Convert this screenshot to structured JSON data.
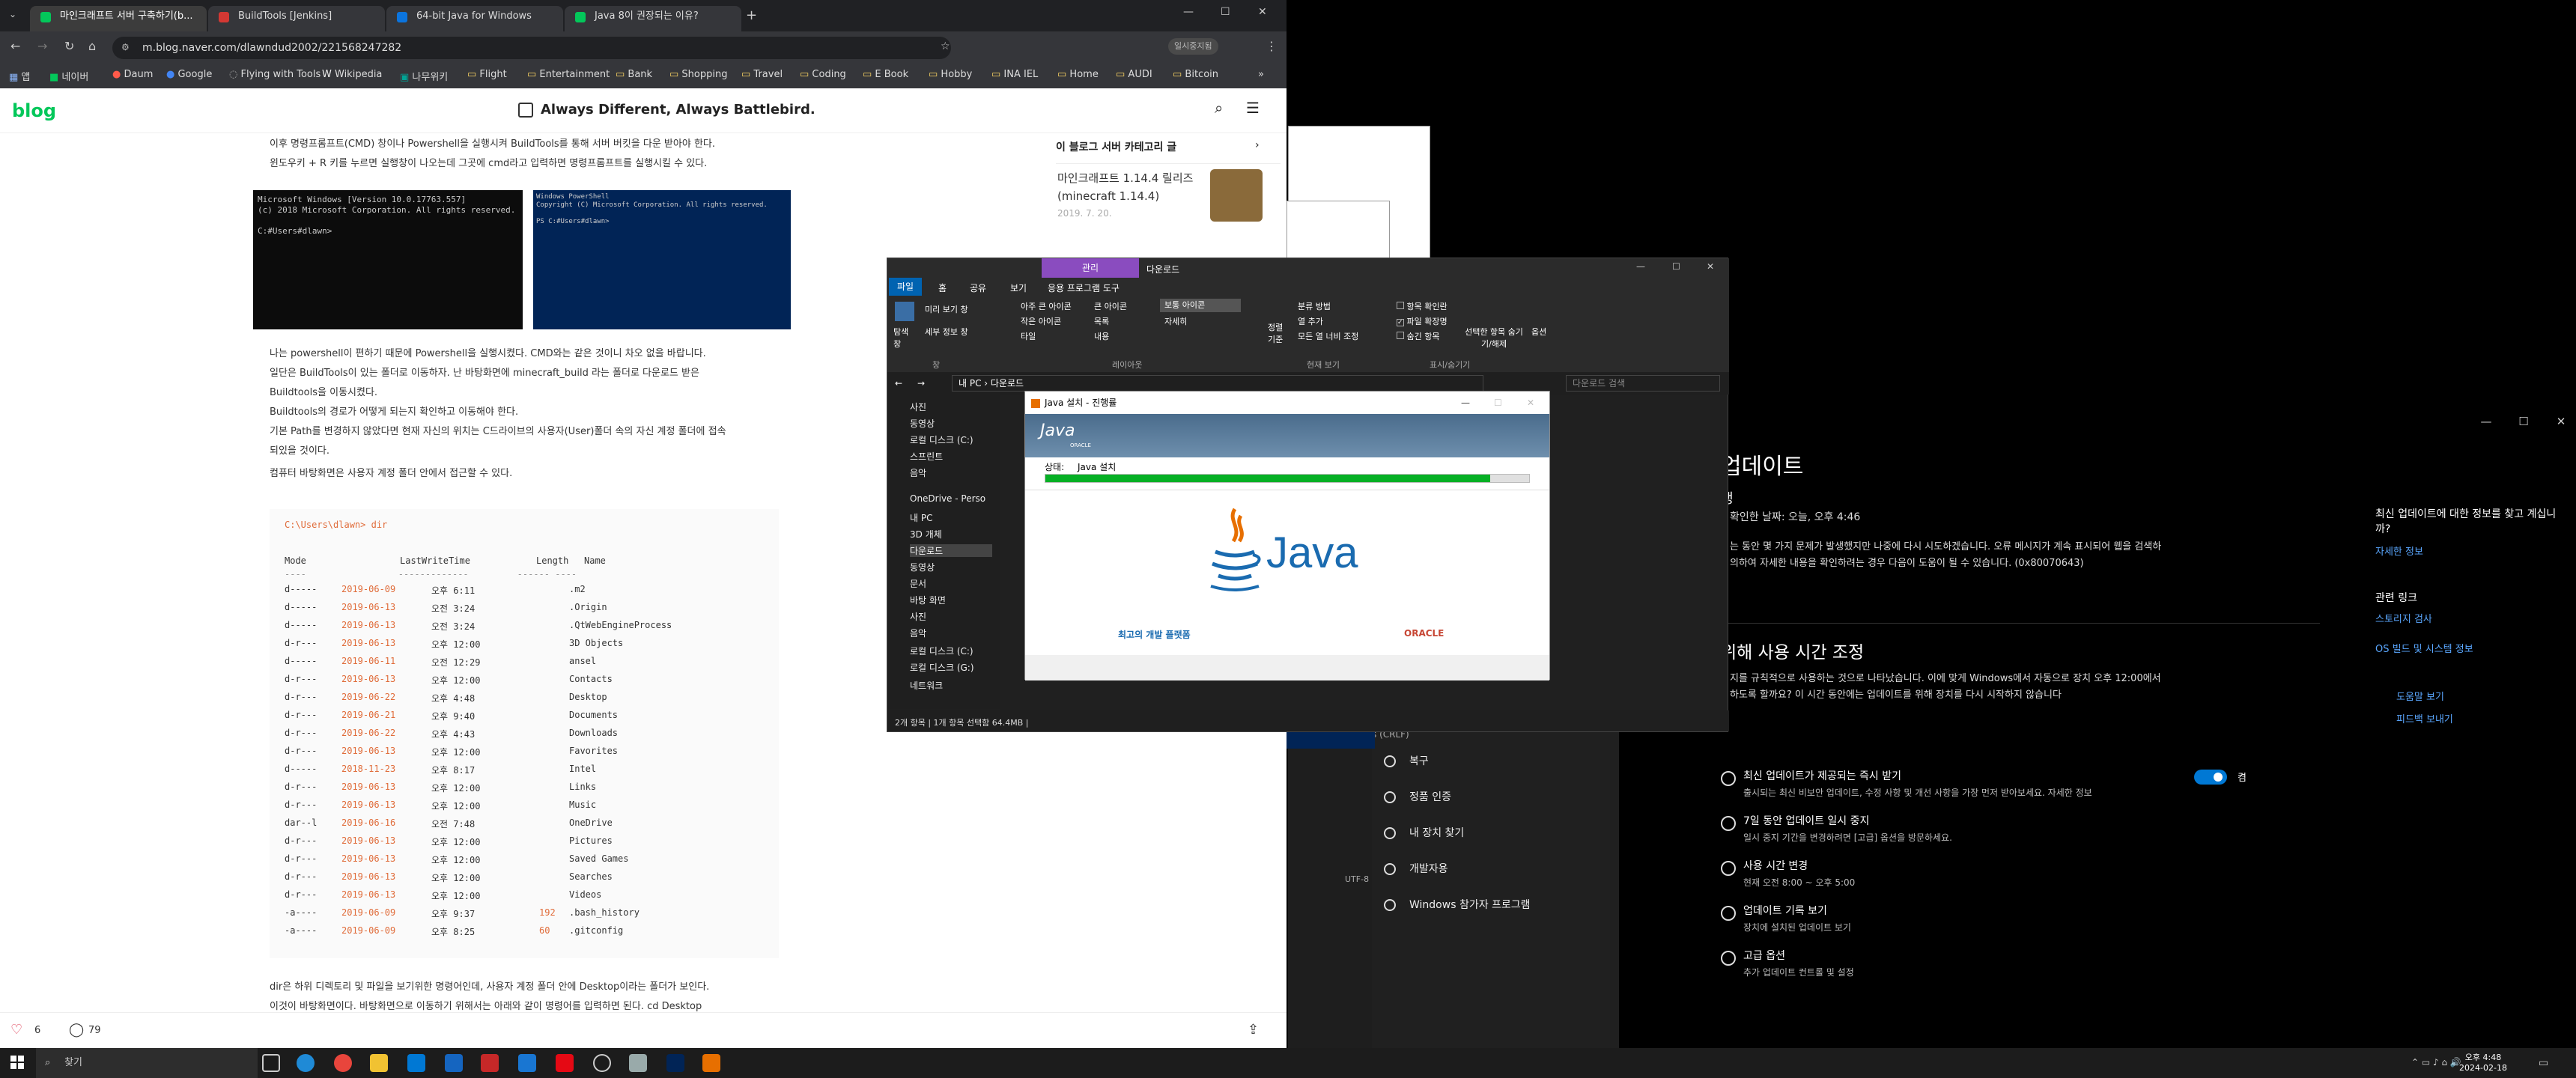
{
  "chrome": {
    "tabs": [
      {
        "label": "마인크래프트 서버 구축하기(b...",
        "color": "#03c75a"
      },
      {
        "label": "BuildTools [Jenkins]",
        "color": "#d33833"
      },
      {
        "label": "64-bit Java for Windows",
        "color": "#0b74de"
      },
      {
        "label": "Java 8이 권장되는 이유?",
        "color": "#03c75a"
      }
    ],
    "url": "m.blog.naver.com/dlawndud2002/221568247282",
    "profile_badge": "일시중지됨",
    "bookmarks": [
      "앱",
      "네이버",
      "Daum",
      "Google",
      "Flying with Tools",
      "Wikipedia",
      "나무위키",
      "Flight",
      "Entertainment",
      "Bank",
      "Shopping",
      "Travel",
      "Coding",
      "E Book",
      "Hobby",
      "INA IEL",
      "Home",
      "AUDI",
      "Bitcoin"
    ],
    "blog_logo": "blog",
    "blog_title": "Always Different, Always Battlebird.",
    "paragraphs": [
      "이후 명령프롬프트(CMD) 창이나 Powershell을 실행시켜 BuildTools를 통해 서버 버킷을 다운 받아야 한다.",
      "윈도우키 + R 키를 누르면 실행창이 나오는데 그곳에 cmd라고 입력하면 명령프롬프트를 실행시킬 수 있다."
    ],
    "paragraphs2": [
      "나는 powershell이 편하기 때문에 Powershell을 실행시켰다. CMD와는 같은 것이니 차오 없을 바랍니다.",
      "일단은 BuildTools이 있는 폴더로 이동하자. 난 바탕화면에 minecraft_build 라는 폴더로 다운로드 받은",
      "Buildtools을 이동시켰다.",
      "Buildtools의 경로가 어떻게 되는지 확인하고 이동해야 한다.",
      "기본 Path를 변경하지 않았다면 현재 자신의 위치는 C드라이브의 사용자(User)폴더 속의 자신 계정 폴더에 접속",
      "되있을 것이다.",
      "컴퓨터 바탕화면은 사용자 계정 폴더 안에서 접근할 수 있다."
    ],
    "cmd1_text": "Microsoft Windows [Version 10.0.17763.557]\n(c) 2018 Microsoft Corporation. All rights reserved.\n\nC:#Users#dlawn>",
    "cmd2_text": "Windows PowerShell\nCopyright (C) Microsoft Corporation. All rights reserved.\n\nPS C:#Users#dlawn>",
    "code_prompt": "C:\\Users\\dlawn> dir",
    "code_headers": [
      "Mode",
      "LastWriteTime",
      "Length",
      "Name"
    ],
    "code_rows": [
      [
        "d-----",
        "2019-06-09",
        "오후 6:11",
        "",
        ".m2"
      ],
      [
        "d-----",
        "2019-06-13",
        "오전 3:24",
        "",
        ".Origin"
      ],
      [
        "d-----",
        "2019-06-13",
        "오전 3:24",
        "",
        ".QtWebEngineProcess"
      ],
      [
        "d-r---",
        "2019-06-13",
        "오후 12:00",
        "",
        "3D Objects"
      ],
      [
        "d-----",
        "2019-06-11",
        "오전 12:29",
        "",
        "ansel"
      ],
      [
        "d-r---",
        "2019-06-13",
        "오후 12:00",
        "",
        "Contacts"
      ],
      [
        "d-r---",
        "2019-06-22",
        "오후 4:48",
        "",
        "Desktop"
      ],
      [
        "d-r---",
        "2019-06-21",
        "오후 9:40",
        "",
        "Documents"
      ],
      [
        "d-r---",
        "2019-06-22",
        "오후 4:43",
        "",
        "Downloads"
      ],
      [
        "d-r---",
        "2019-06-13",
        "오후 12:00",
        "",
        "Favorites"
      ],
      [
        "d-----",
        "2018-11-23",
        "오후 8:17",
        "",
        "Intel"
      ],
      [
        "d-r---",
        "2019-06-13",
        "오후 12:00",
        "",
        "Links"
      ],
      [
        "d-r---",
        "2019-06-13",
        "오후 12:00",
        "",
        "Music"
      ],
      [
        "dar--l",
        "2019-06-16",
        "오전 7:48",
        "",
        "OneDrive"
      ],
      [
        "d-r---",
        "2019-06-13",
        "오후 12:00",
        "",
        "Pictures"
      ],
      [
        "d-r---",
        "2019-06-13",
        "오후 12:00",
        "",
        "Saved Games"
      ],
      [
        "d-r---",
        "2019-06-13",
        "오후 12:00",
        "",
        "Searches"
      ],
      [
        "d-r---",
        "2019-06-13",
        "오후 12:00",
        "",
        "Videos"
      ],
      [
        "-a----",
        "2019-06-09",
        "오후 9:37",
        "192",
        ".bash_history"
      ],
      [
        "-a----",
        "2019-06-09",
        "오후 8:25",
        "60",
        ".gitconfig"
      ]
    ],
    "bottom_para1": "dir은 하위 디렉토리 및 파일을 보기위한 명령어인데, 사용자 계정 폴더 안에 Desktop이라는 폴더가 보인다.",
    "bottom_para2": "이것이 바탕화면이다. 바탕화면으로 이동하기 위해서는 아래와 같이 명령어를 입력하면 된다. cd Desktop",
    "likes": "6",
    "comments": "79",
    "sidebar": {
      "heading": "이 블로그 서버 카테고리 글",
      "heading_accent": "서버",
      "post_title": "마인크래프트 1.14.4 릴리즈 (minecraft 1.14.4)",
      "post_date": "2019. 7. 20."
    }
  },
  "explorer": {
    "title_tab_manage": "관리",
    "title_tab_downloads": "다운로드",
    "ribbon_tabs": [
      "파일",
      "홈",
      "공유",
      "보기",
      "응용 프로그램 도구"
    ],
    "ribbon_items": [
      "탐색 창",
      "미리 보기 창",
      "세부 정보 창",
      "아주 큰 아이콘",
      "큰 아이콘",
      "보통 아이콘",
      "작은 아이콘",
      "목록",
      "자세히",
      "타일",
      "내용",
      "정렬 기준",
      "분류 방법",
      "열 추가",
      "모든 열 너비 조정",
      "항목 확인란",
      "파일 확장명",
      "숨긴 항목",
      "선택한 항목 숨기기/해제",
      "옵션"
    ],
    "ribbon_groups": [
      "창",
      "레이아웃",
      "현재 보기",
      "표시/숨기기"
    ],
    "breadcrumb": [
      "내 PC",
      "다운로드"
    ],
    "search_placeholder": "다운로드 검색",
    "nav": [
      "사진",
      "동영상",
      "로컬 디스크 (C:)",
      "스프린트",
      "음악",
      "OneDrive - Perso",
      "내 PC",
      "3D 개체",
      "다운로드",
      "동영상",
      "문서",
      "바탕 화면",
      "사진",
      "음악",
      "로컬 디스크 (C:)",
      "로컬 디스크 (G:)",
      "네트워크"
    ],
    "status": "2개 항목  |  1개 항목 선택함 64.4MB  |"
  },
  "java_installer": {
    "title": "Java 설치 - 진행률",
    "status_label": "상태:",
    "status_value": "Java 설치",
    "progress": 0.92,
    "logo_text": "Java",
    "oracle_small": "ORACLE",
    "tagline": "최고의 개발 플랫폼",
    "oracle": "ORACLE"
  },
  "settings": {
    "heading": "업데이트",
    "status_title": "생",
    "checked": "확인한 날짜: 오늘, 오후 4:46",
    "error_line1": "는 동안 몇 가지 문제가 발생했지만 나중에 다시 시도하겠습니다. 오류 메시지가 계속 표시되어 웹을 검색하",
    "error_line2": "의하여 자세한 내용을 확인하려는 경우 다음이 도움이 될 수 있습니다. (0x80070643)",
    "active_hours_title": "위해 사용 시간 조정",
    "active_hours_line1": "지를 규칙적으로 사용하는 것으로 나타났습니다. 이에 맞게 Windows에서 자동으로 장치 오후 12:00에서",
    "active_hours_line2": "하도록 할까요? 이 시간 동안에는 업데이트를 위해 장치를 다시 시작하지 않습니다",
    "options": [
      {
        "title": "최신 업데이트가 제공되는 즉시 받기",
        "desc": "출시되는 최신 비보안 업데이트, 수정 사항 및 개선 사항을 가장 먼저 받아보세요. 자세한 정보",
        "toggle": "켬"
      },
      {
        "title": "7일 동안 업데이트 일시 중지",
        "desc": "일시 중지 기간을 변경하려면 [고급] 옵션을 방문하세요."
      },
      {
        "title": "사용 시간 변경",
        "desc": "현재 오전 8:00 ~ 오후 5:00"
      },
      {
        "title": "업데이트 기록 보기",
        "desc": "장치에 설치된 업데이트 보기"
      },
      {
        "title": "고급 옵션",
        "desc": "추가 업데이트 컨트롤 및 설정"
      }
    ],
    "side": {
      "info_q": "최신 업데이트에 대한 정보를 찾고 계십니까?",
      "info_link": "자세한 정보",
      "related": "관련 링크",
      "storage": "스토리지 검사",
      "build": "OS 빌드 및 시스템 정보",
      "help": "도움말 보기",
      "feedback": "피드백 보내기"
    },
    "leftnav": [
      "복구",
      "정품 인증",
      "내 장치 찾기",
      "개발자용",
      "Windows 참가자 프로그램"
    ],
    "crlf": "s (CRLF)",
    "utf": "UTF-8"
  },
  "taskbar": {
    "search": "찾기",
    "time": "오후 4:48",
    "date": "2024-02-18"
  }
}
